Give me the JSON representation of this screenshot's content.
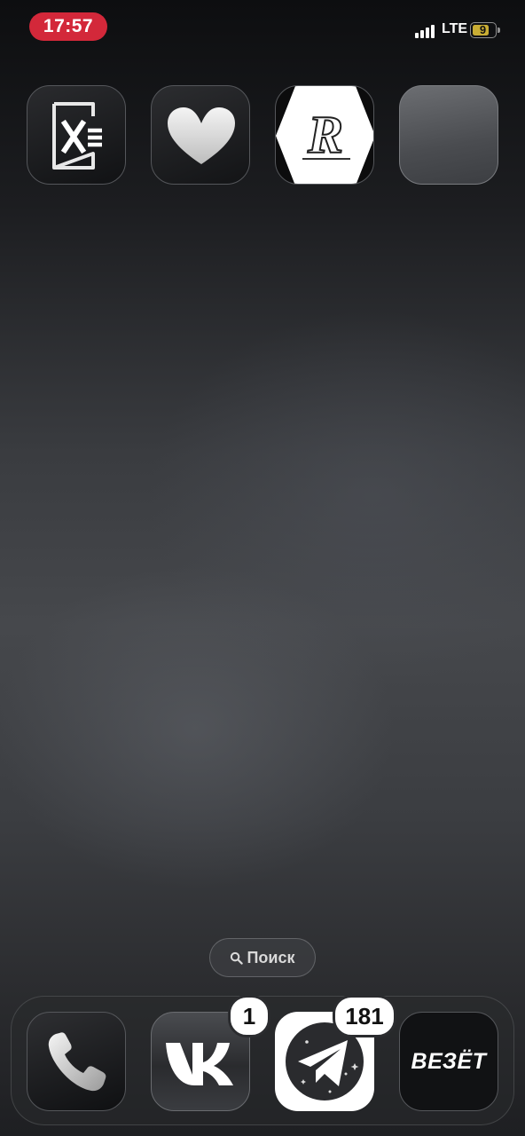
{
  "status_bar": {
    "time": "17:57",
    "network": "LTE",
    "battery": "9",
    "time_pill_color": "#d3283a",
    "battery_color": "#c9ad34"
  },
  "home_apps": [
    {
      "icon": "formula-x-icon"
    },
    {
      "icon": "heart-icon"
    },
    {
      "icon": "r-logo-icon"
    },
    {
      "icon": "blank-app-icon"
    }
  ],
  "search": {
    "label": "Поиск",
    "icon": "search-icon"
  },
  "dock": [
    {
      "icon": "phone-icon"
    },
    {
      "icon": "vk-icon",
      "badge": "1"
    },
    {
      "icon": "telegram-icon",
      "badge": "181"
    },
    {
      "icon": "vezet-icon",
      "label": "ВЕЗЁТ"
    }
  ]
}
